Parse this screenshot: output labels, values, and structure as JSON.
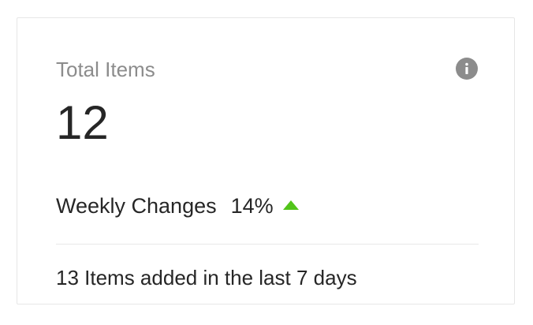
{
  "card": {
    "title": "Total Items",
    "info_icon": "info-icon",
    "value": "12",
    "weekly": {
      "label": "Weekly Changes",
      "value": "14%",
      "trend_icon": "trend-up-icon",
      "trend_color": "#52c41a"
    },
    "footer": "13 Items added in the last 7 days"
  }
}
